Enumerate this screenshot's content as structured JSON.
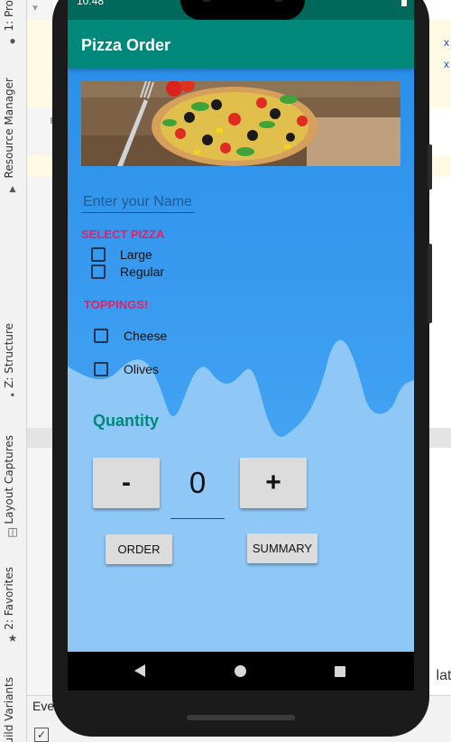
{
  "ide": {
    "tabs": [
      {
        "label": "1: Pro"
      },
      {
        "label": "Resource Manager"
      },
      {
        "label": "Z: Structure"
      },
      {
        "label": "Layout Captures"
      },
      {
        "label": "2: Favorites"
      },
      {
        "label": "uild Variants"
      }
    ],
    "bottom_text": "Eve",
    "right_text": "lati"
  },
  "status_bar": {
    "time": "10:48"
  },
  "app": {
    "title": "Pizza Order",
    "name_placeholder": "Enter your Name",
    "select_pizza_label": "SELECT PIZZA",
    "pizza_options": [
      {
        "label": "Large",
        "checked": false
      },
      {
        "label": "Regular",
        "checked": false
      }
    ],
    "toppings_label": "TOPPINGS!",
    "topping_options": [
      {
        "label": "Cheese",
        "checked": false
      },
      {
        "label": "Olives",
        "checked": false
      }
    ],
    "quantity_label": "Quantity",
    "minus_label": "-",
    "plus_label": "+",
    "quantity_value": "0",
    "order_label": "ORDER",
    "summary_label": "SUMMARY"
  },
  "colors": {
    "appbar": "#00897b",
    "statusbar": "#00695c",
    "section_label": "#e91e63",
    "quantity_label": "#00897b",
    "content_bg": "#3fa0f2"
  }
}
